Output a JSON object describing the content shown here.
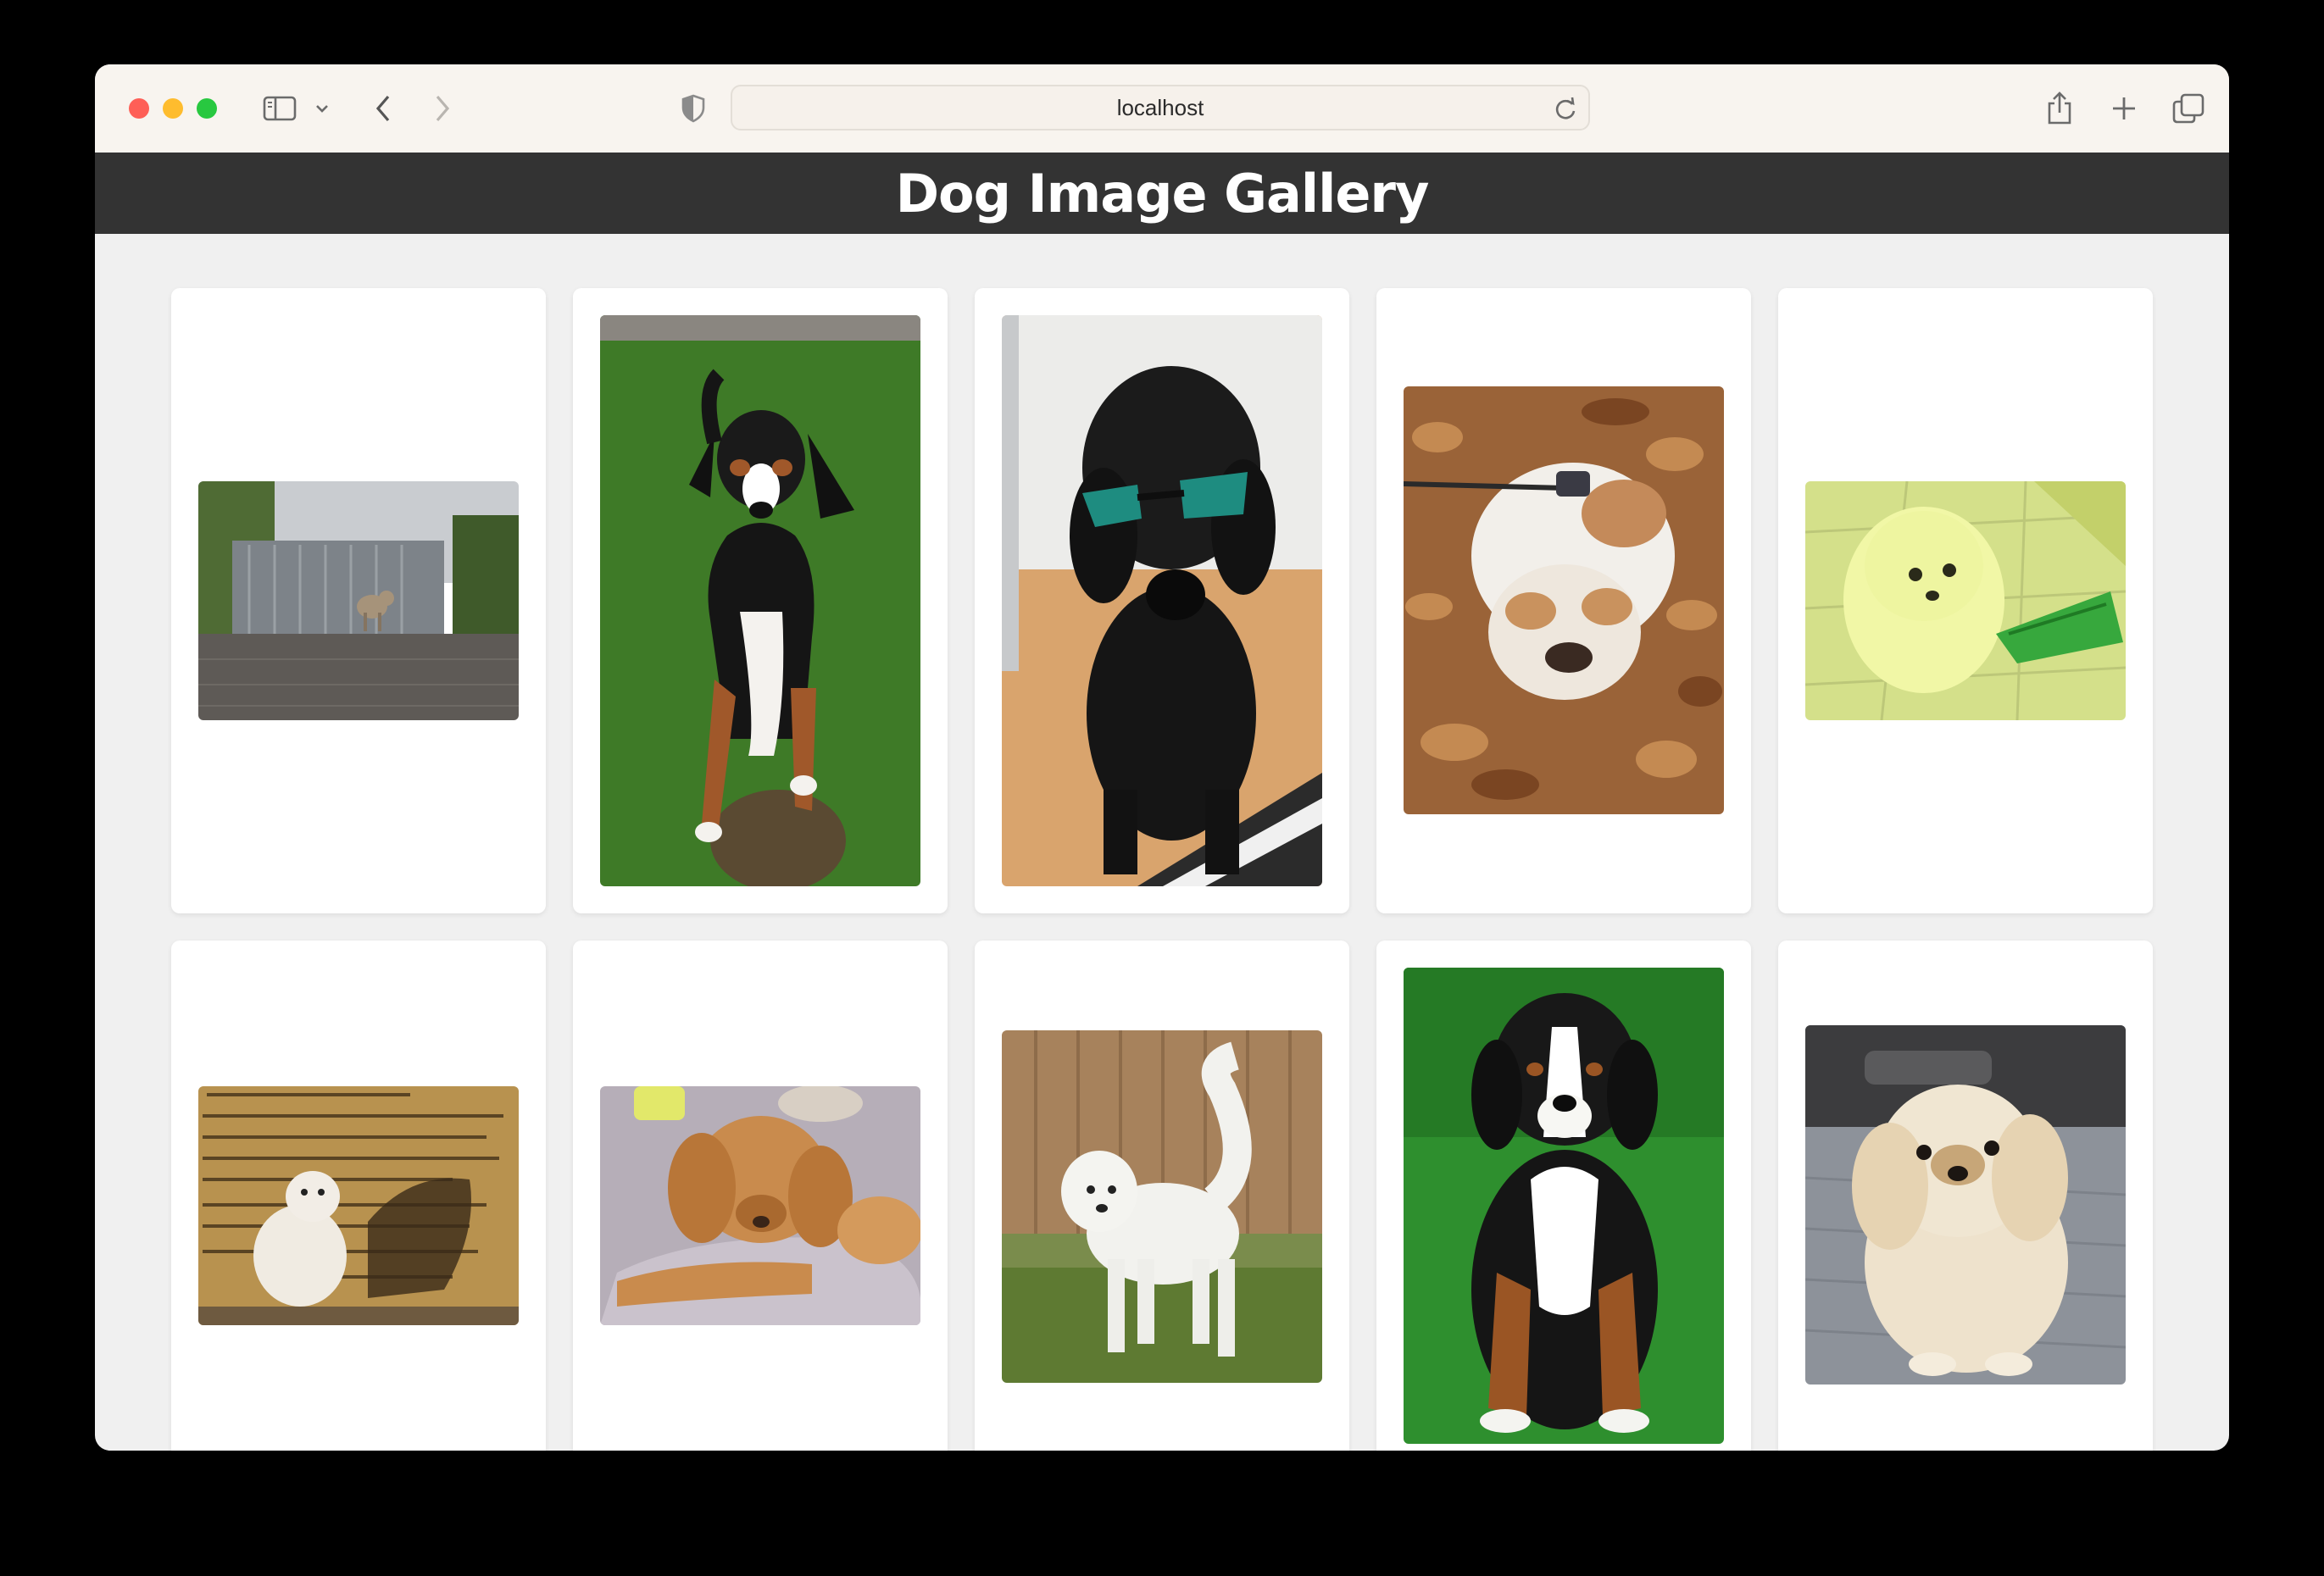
{
  "browser": {
    "url": "localhost"
  },
  "page": {
    "title": "Dog Image Gallery"
  },
  "gallery": {
    "images": [
      {
        "name": "dog-photo-gate"
      },
      {
        "name": "dog-photo-tricolor-grass"
      },
      {
        "name": "dog-photo-poodle-sunglasses"
      },
      {
        "name": "dog-photo-bulldog-leaves"
      },
      {
        "name": "dog-photo-white-puppy"
      },
      {
        "name": "dog-photo-foundation-stone"
      },
      {
        "name": "dog-photo-cocker-puppy"
      },
      {
        "name": "dog-photo-white-fluffy"
      },
      {
        "name": "dog-photo-bernese"
      },
      {
        "name": "dog-photo-pekingese"
      }
    ]
  }
}
